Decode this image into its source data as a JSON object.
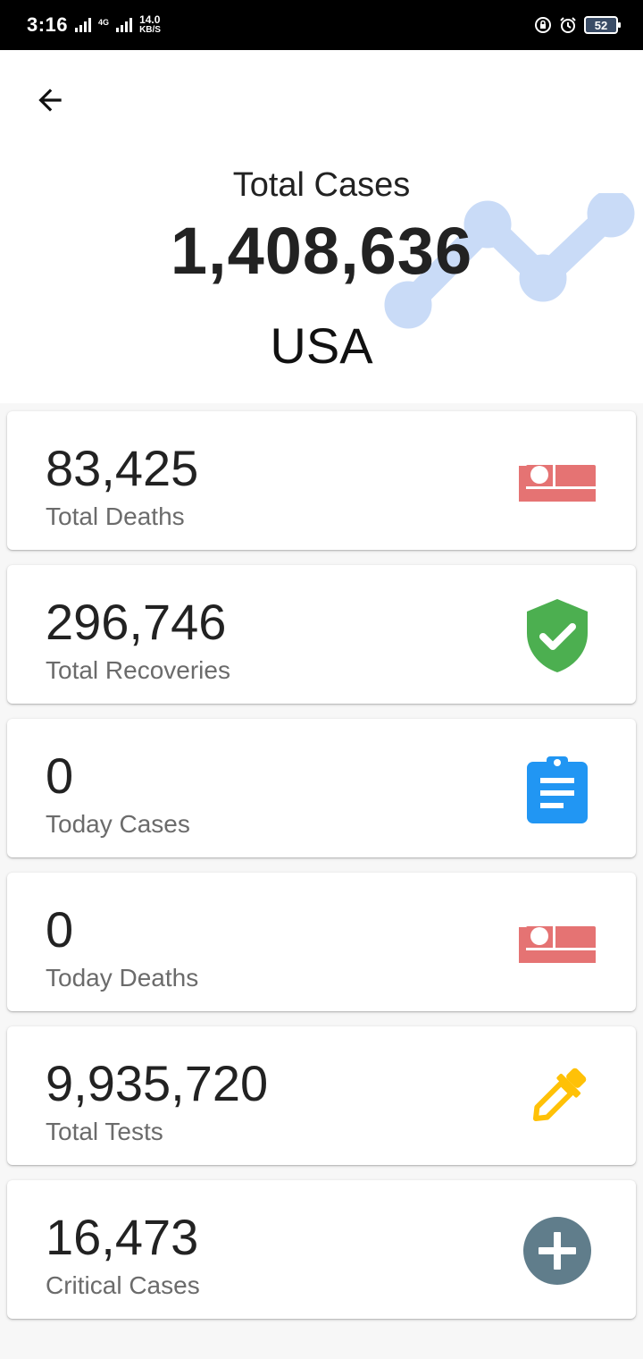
{
  "status_bar": {
    "time": "3:16",
    "network": "4G",
    "speed_value": "14.0",
    "speed_unit": "KB/S",
    "battery": "52"
  },
  "header": {
    "title": "Total Cases",
    "total": "1,408,636",
    "country": "USA"
  },
  "stats": [
    {
      "value": "83,425",
      "label": "Total Deaths",
      "icon": "bed-icon",
      "color": "#e57373"
    },
    {
      "value": "296,746",
      "label": "Total Recoveries",
      "icon": "verified-shield-icon",
      "color": "#4caf50"
    },
    {
      "value": "0",
      "label": "Today Cases",
      "icon": "clipboard-icon",
      "color": "#2196f3"
    },
    {
      "value": "0",
      "label": "Today Deaths",
      "icon": "bed-icon",
      "color": "#e57373"
    },
    {
      "value": "9,935,720",
      "label": "Total Tests",
      "icon": "dropper-icon",
      "color": "#ffc107"
    },
    {
      "value": "16,473",
      "label": "Critical Cases",
      "icon": "add-circle-icon",
      "color": "#607d8b"
    }
  ],
  "colors": {
    "decor_chart": "#c9dbf7"
  }
}
